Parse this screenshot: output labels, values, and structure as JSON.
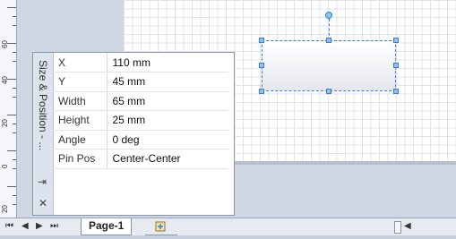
{
  "panel": {
    "title": "Size & Position - ...",
    "pin_icon": "pin-icon",
    "close_icon": "close-icon",
    "rows": [
      {
        "label": "X",
        "value": "110 mm"
      },
      {
        "label": "Y",
        "value": "45 mm"
      },
      {
        "label": "Width",
        "value": "65 mm"
      },
      {
        "label": "Height",
        "value": "25 mm"
      },
      {
        "label": "Angle",
        "value": "0 deg"
      },
      {
        "label": "Pin Pos",
        "value": "Center-Center"
      }
    ]
  },
  "ruler": {
    "labels": [
      "60",
      "40",
      "20",
      "0",
      "20"
    ]
  },
  "tabs": {
    "first_icon": "first-page-icon",
    "prev_icon": "previous-page-icon",
    "next_icon": "next-page-icon",
    "last_icon": "last-page-icon",
    "page_label": "Page-1",
    "insert_icon": "insert-page-icon"
  },
  "colors": {
    "selection": "#3a7fd0",
    "handle": "#8fc1ef"
  }
}
